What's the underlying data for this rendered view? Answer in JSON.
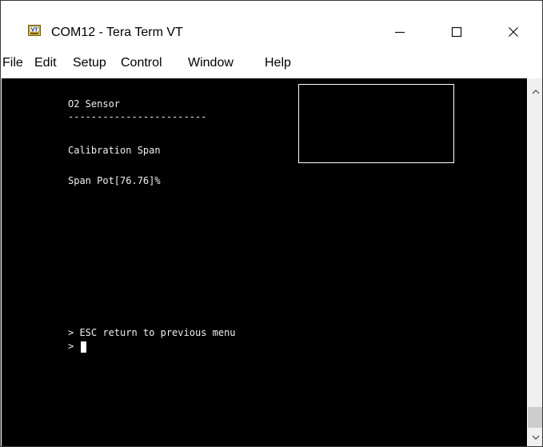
{
  "window": {
    "title": "COM12 - Tera Term VT",
    "icon": "tera-term-vt-icon"
  },
  "window_controls": {
    "minimize": "—",
    "maximize": "☐",
    "close": "✕"
  },
  "menu": {
    "items": [
      {
        "label": "File"
      },
      {
        "label": "Edit"
      },
      {
        "label": "Setup"
      },
      {
        "label": "Control"
      },
      {
        "label": "Window"
      },
      {
        "label": "Help"
      }
    ]
  },
  "terminal": {
    "lines": [
      "O2 Sensor",
      "------------------------",
      "Calibration Span",
      "Span Pot[76.76]%",
      "> ESC return to previous menu",
      ">"
    ],
    "background": "#000000",
    "foreground": "#f0f0f0"
  },
  "scrollbar": {
    "up_icon": "chevron-up-icon",
    "down_icon": "chevron-down-icon"
  }
}
